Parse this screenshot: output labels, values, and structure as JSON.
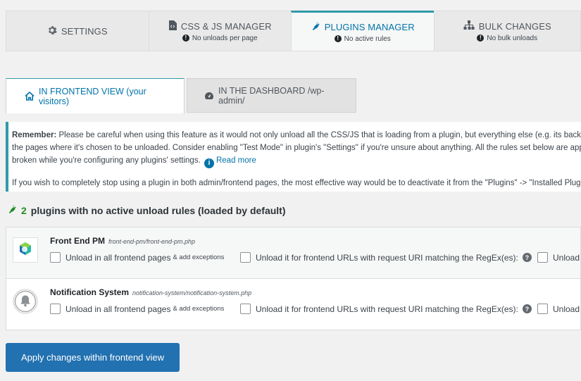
{
  "top_tabs": [
    {
      "label": "SETTINGS",
      "sub": "",
      "icon": "gear-icon"
    },
    {
      "label": "CSS & JS MANAGER",
      "sub": "No unloads per page",
      "icon": "code-file-icon"
    },
    {
      "label": "PLUGINS MANAGER",
      "sub": "No active rules",
      "icon": "plug-icon"
    },
    {
      "label": "BULK CHANGES",
      "sub": "No bulk unloads",
      "icon": "sitemap-icon"
    }
  ],
  "sub_tabs": [
    {
      "label": "IN FRONTEND VIEW (your visitors)",
      "icon": "home-icon"
    },
    {
      "label": "IN THE DASHBOARD /wp-admin/",
      "icon": "dashboard-gauge-icon"
    }
  ],
  "notice": {
    "strong": "Remember:",
    "line1": " Please be careful when using this feature as it would not only unload all the CSS/JS that is loading from a plugin, but everything else (e.g. its backend code)",
    "line2": "the pages where it's chosen to be unloaded. Consider enabling \"Test Mode\" in plugin's \"Settings\" if you're unsure about anything. All the rules set below are applied",
    "line3": "broken while you're configuring any plugins' settings.",
    "read_more": "Read more",
    "line4": "If you wish to completely stop using a plugin in both admin/frontend pages, the most effective way would be to deactivate it from the \"Plugins\" -> \"Installed Plugins\""
  },
  "heading": {
    "count": "2",
    "text": "plugins with no active unload rules (loaded by default)"
  },
  "plugins": [
    {
      "name": "Front End PM",
      "path": "front-end-pm/front-end-pm.php",
      "opt1": "Unload in all frontend pages",
      "opt1_small": "& add exceptions",
      "opt2": "Unload it for frontend URLs with request URI matching the RegEx(es):",
      "opt3": "Unload it"
    },
    {
      "name": "Notification System",
      "path": "notification-system/notification-system.php",
      "opt1": "Unload in all frontend pages",
      "opt1_small": "& add exceptions",
      "opt2": "Unload it for frontend URLs with request URI matching the RegEx(es):",
      "opt3": "Unload it"
    }
  ],
  "apply_label": "Apply changes within frontend view",
  "colors": {
    "accent": "#2f9aa8",
    "link": "#0073aa",
    "button": "#2271b1",
    "green": "#228b22"
  }
}
